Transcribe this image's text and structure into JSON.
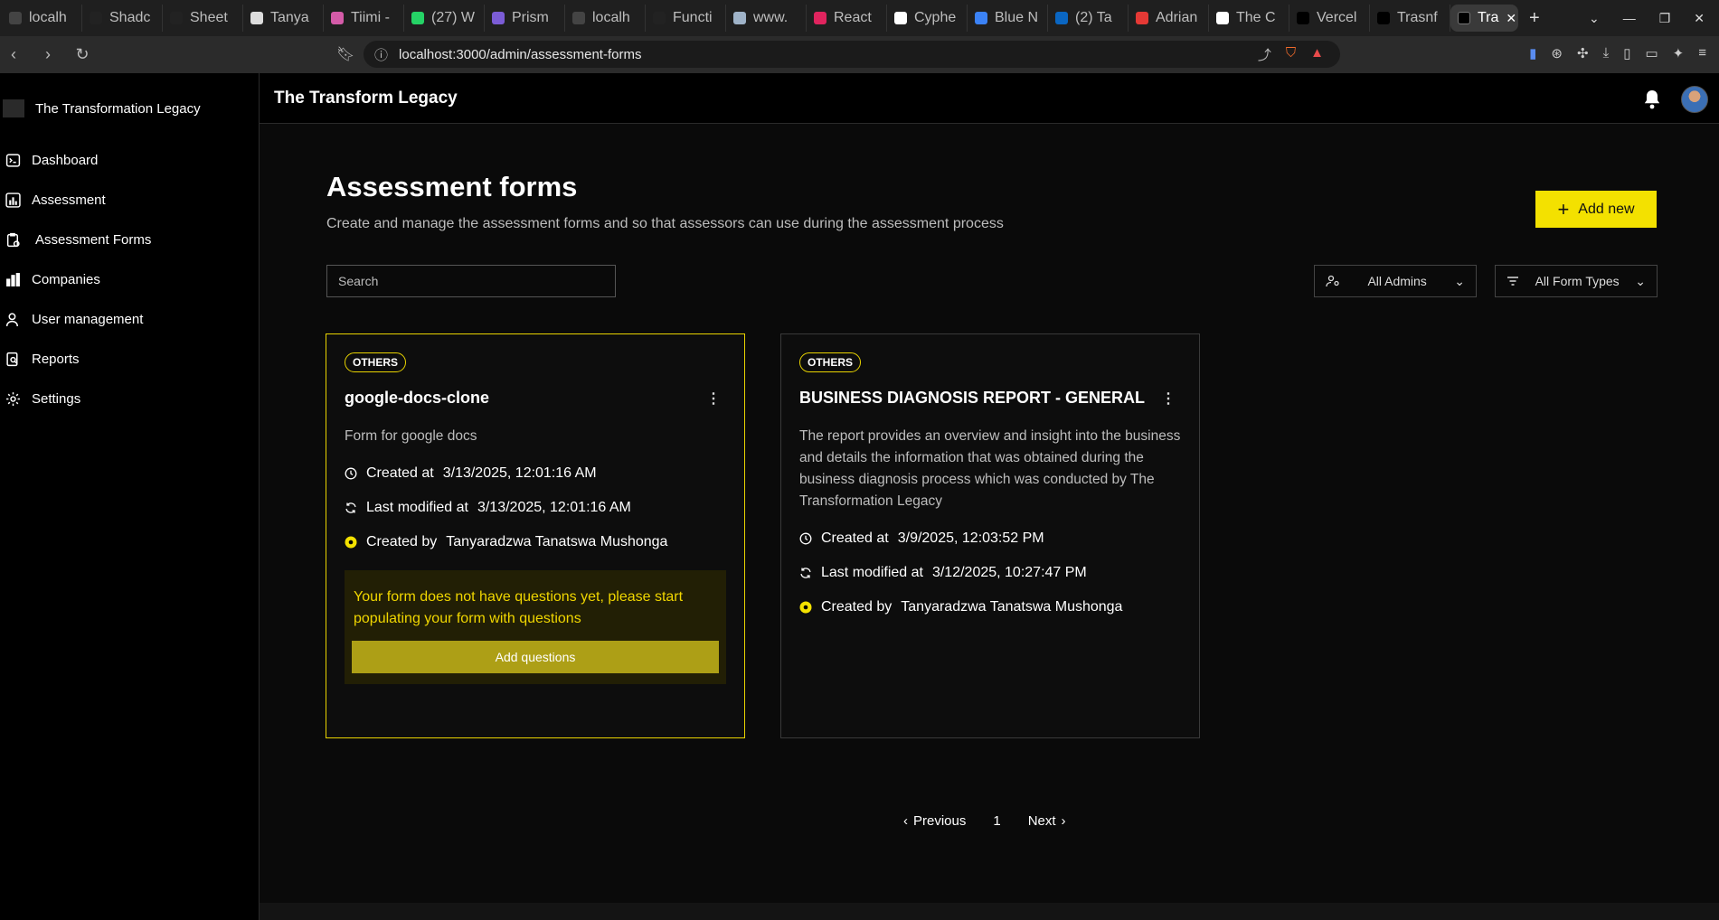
{
  "browser": {
    "tabs": [
      {
        "label": "localh",
        "color": "#444"
      },
      {
        "label": "Shadc",
        "color": "#222"
      },
      {
        "label": "Sheet",
        "color": "#222"
      },
      {
        "label": "Tanya",
        "color": "#ddd"
      },
      {
        "label": "Tiimi -",
        "color": "#d45ba8"
      },
      {
        "label": "(27) W",
        "color": "#25d366"
      },
      {
        "label": "Prism",
        "color": "#7b5cd6"
      },
      {
        "label": "localh",
        "color": "#444"
      },
      {
        "label": "Functi",
        "color": "#222"
      },
      {
        "label": "www.",
        "color": "#9fb3c8"
      },
      {
        "label": "React",
        "color": "#e0245e"
      },
      {
        "label": "Cyphe",
        "color": "#fff"
      },
      {
        "label": "Blue N",
        "color": "#3b82f6"
      },
      {
        "label": "(2) Ta",
        "color": "#0a66c2"
      },
      {
        "label": "Adrian",
        "color": "#e53935"
      },
      {
        "label": "The C",
        "color": "#fff"
      },
      {
        "label": "Vercel",
        "color": "#000"
      },
      {
        "label": "Trasnf",
        "color": "#000"
      }
    ],
    "active_tab": {
      "label": "Tra"
    },
    "url": "localhost:3000/admin/assessment-forms"
  },
  "sidebar": {
    "brand": "The Transformation Legacy",
    "items": [
      {
        "label": "Dashboard",
        "icon": "terminal-icon"
      },
      {
        "label": "Assessment",
        "icon": "bar-chart-icon"
      },
      {
        "label": "Assessment Forms",
        "icon": "clipboard-icon"
      },
      {
        "label": "Companies",
        "icon": "buildings-icon"
      },
      {
        "label": "User management",
        "icon": "user-icon"
      },
      {
        "label": "Reports",
        "icon": "report-search-icon"
      },
      {
        "label": "Settings",
        "icon": "gear-icon"
      }
    ]
  },
  "topbar": {
    "title": "The Transform Legacy"
  },
  "page": {
    "title": "Assessment forms",
    "description": "Create and manage the assessment forms and so that assessors can use during the assessment process",
    "add_label": "Add new",
    "search_placeholder": "Search",
    "filter_admins": "All Admins",
    "filter_types": "All Form Types"
  },
  "cards": [
    {
      "badge": "OTHERS",
      "title": "google-docs-clone",
      "description": "Form for google docs",
      "created_label": "Created at",
      "created": "3/13/2025, 12:01:16 AM",
      "modified_label": "Last modified at",
      "modified": "3/13/2025, 12:01:16 AM",
      "author_label": "Created by",
      "author": "Tanyaradzwa Tanatswa Mushonga",
      "warning": "Your form does not have questions yet, please start populating your form with questions",
      "action": "Add questions"
    },
    {
      "badge": "OTHERS",
      "title": "BUSINESS DIAGNOSIS REPORT - GENERAL",
      "description": "The report provides an overview and insight into the business and details the information that was obtained during the business diagnosis process which was conducted by The Transformation Legacy",
      "created_label": "Created at",
      "created": "3/9/2025, 12:03:52 PM",
      "modified_label": "Last modified at",
      "modified": "3/12/2025, 10:27:47 PM",
      "author_label": "Created by",
      "author": "Tanyaradzwa Tanatswa Mushonga"
    }
  ],
  "pagination": {
    "prev": "Previous",
    "page": "1",
    "next": "Next"
  },
  "colors": {
    "accent": "#f3e100",
    "background": "#0a0a0a",
    "sidebar": "#000000"
  }
}
